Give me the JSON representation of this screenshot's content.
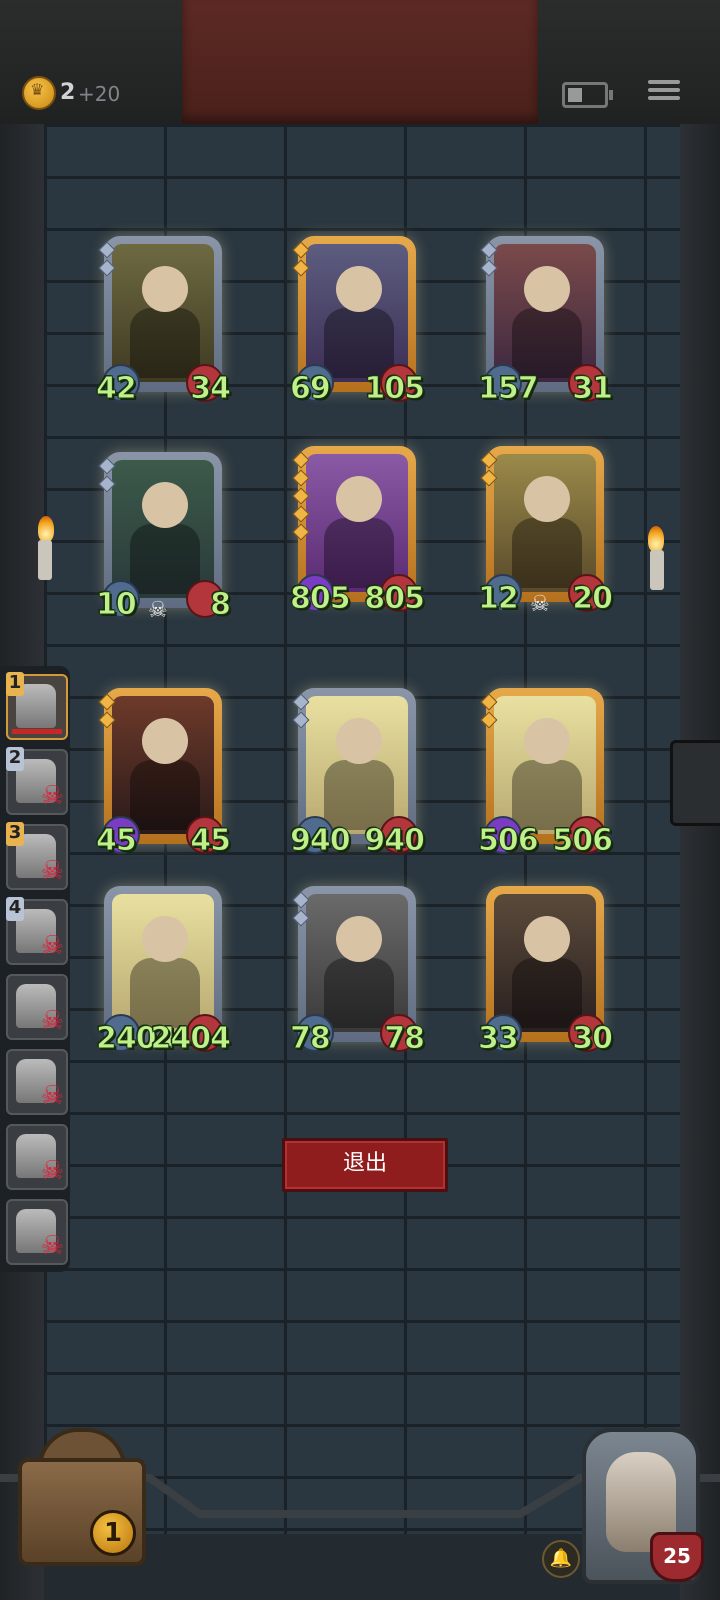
{
  "header": {
    "coins": "2",
    "coins_income": "+20",
    "coin_icon": "crown-coin-icon",
    "battery_icon": "battery-icon",
    "menu_icon": "menu-icon"
  },
  "board": {
    "cards": [
      {
        "id": "swamp-witch",
        "rank": "silver",
        "pips": 2,
        "attack": "42",
        "health": "34",
        "frame": "silver"
      },
      {
        "id": "elf-sorceress",
        "rank": "gold",
        "pips": 2,
        "attack": "69",
        "health": "105",
        "frame": "gold"
      },
      {
        "id": "clown-jester",
        "rank": "silver",
        "pips": 2,
        "attack": "157",
        "health": "31",
        "frame": "silver",
        "health_effect": "target-icon"
      },
      {
        "id": "beanstalk-egg",
        "rank": "silver",
        "pips": 2,
        "attack": "10",
        "health": "8",
        "frame": "silver",
        "deathrattle": "skull-icon"
      },
      {
        "id": "leaf-sprout",
        "rank": "gold",
        "pips": 5,
        "attack": "805",
        "health": "805",
        "frame": "gold",
        "attack_effect": "poison-flame-icon"
      },
      {
        "id": "pinocchio",
        "rank": "gold",
        "pips": 2,
        "attack": "12",
        "health": "20",
        "frame": "gold",
        "deathrattle": "skull-icon"
      },
      {
        "id": "hooded-assassin",
        "rank": "gold",
        "pips": 2,
        "attack": "45",
        "health": "45",
        "frame": "gold",
        "attack_effect": "poison-flame-icon"
      },
      {
        "id": "dwarf-warrior-silver",
        "rank": "silver",
        "pips": 2,
        "attack": "940",
        "health": "940",
        "frame": "silver"
      },
      {
        "id": "dwarf-warrior-gold",
        "rank": "gold",
        "pips": 2,
        "attack": "506",
        "health": "506",
        "frame": "gold",
        "attack_effect": "poison-flame-icon"
      },
      {
        "id": "dwarf-warrior-base",
        "rank": "silver",
        "pips": 0,
        "attack": "2404",
        "health": "2404",
        "frame": "silver"
      },
      {
        "id": "lumberjack",
        "rank": "silver",
        "pips": 2,
        "attack": "78",
        "health": "78",
        "frame": "silver"
      },
      {
        "id": "masked-rabbit",
        "rank": "gold",
        "pips": 0,
        "attack": "33",
        "health": "30",
        "frame": "gold"
      }
    ]
  },
  "turn_order": {
    "slots": [
      {
        "number": "1",
        "badge": "gold",
        "active": true
      },
      {
        "number": "2",
        "badge": "silver",
        "defeated": true
      },
      {
        "number": "3",
        "badge": "gold",
        "defeated": true
      },
      {
        "number": "4",
        "badge": "silver",
        "defeated": true
      },
      {
        "number": "",
        "defeated": true
      },
      {
        "number": "",
        "defeated": true
      },
      {
        "number": "",
        "defeated": true
      },
      {
        "number": "",
        "defeated": true
      }
    ]
  },
  "exit_button": {
    "label": "退出"
  },
  "footer": {
    "chest_level": "1",
    "boss_health": "25",
    "bell_icon": "bell-icon"
  },
  "colors": {
    "stat_text": "#bff08a",
    "exit_button": "#8f1d1d",
    "gold_frame": "#e6a94a",
    "silver_frame": "#8a96a8",
    "wall": "#2b3740"
  }
}
